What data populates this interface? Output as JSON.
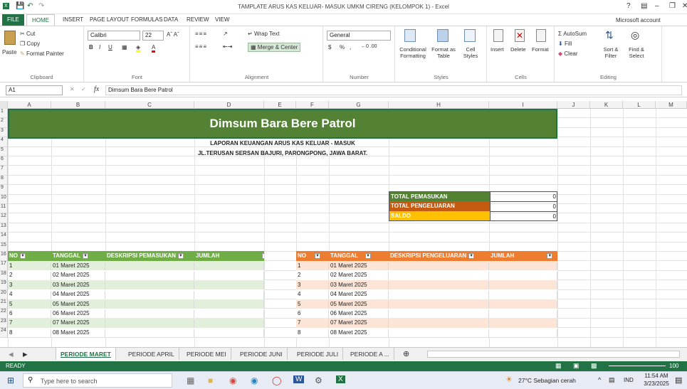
{
  "window": {
    "title": "TAMPLATE ARUS KAS KELUAR- MASUK UMKM CIRENG (KELOMPOK 1) - Excel",
    "help": "?",
    "account": "Microsoft account"
  },
  "tabs": [
    "FILE",
    "HOME",
    "INSERT",
    "PAGE LAYOUT",
    "FORMULAS",
    "DATA",
    "REVIEW",
    "VIEW"
  ],
  "ribbon": {
    "clipboard": {
      "paste": "Paste",
      "cut": "Cut",
      "copy": "Copy",
      "format_painter": "Format Painter",
      "label": "Clipboard"
    },
    "font": {
      "name": "Calibri",
      "size": "22",
      "label": "Font",
      "bold": "B",
      "italic": "I",
      "underline": "U"
    },
    "alignment": {
      "wrap": "Wrap Text",
      "merge": "Merge & Center",
      "label": "Alignment"
    },
    "number": {
      "format": "General",
      "currency": "$",
      "percent": "%",
      "comma": ",",
      "label": "Number"
    },
    "styles": {
      "cond": "Conditional Formatting",
      "table": "Format as Table",
      "cell": "Cell Styles",
      "label": "Styles"
    },
    "cells": {
      "insert": "Insert",
      "delete": "Delete",
      "format": "Format",
      "label": "Cells"
    },
    "editing": {
      "autosum": "AutoSum",
      "fill": "Fill",
      "clear": "Clear",
      "sort": "Sort & Filter",
      "find": "Find & Select",
      "label": "Editing"
    }
  },
  "formula_bar": {
    "name_box": "A1",
    "fx": "fx",
    "content": "Dimsum Bara Bere Patrol"
  },
  "columns": [
    "A",
    "B",
    "C",
    "D",
    "E",
    "F",
    "G",
    "H",
    "I",
    "J",
    "K",
    "L",
    "M"
  ],
  "rows": [
    "1",
    "2",
    "3",
    "4",
    "5",
    "6",
    "7",
    "8",
    "9",
    "10",
    "11",
    "12",
    "13",
    "14",
    "15",
    "16",
    "17",
    "18",
    "19",
    "20",
    "21",
    "22",
    "23",
    "24"
  ],
  "sheet": {
    "title": "Dimsum Bara Bere Patrol",
    "subtitle": "LAPORAN KEUANGAN ARUS KAS KELUAR - MASUK",
    "address": "JL.TERUSAN SERSAN BAJURI, PARONGPONG, JAWA BARAT.",
    "summary": [
      {
        "label": "TOTAL PEMASUKAN",
        "value": "0",
        "color": "#548235"
      },
      {
        "label": "TOTAL PENGELUARAN",
        "value": "0",
        "color": "#c55a11"
      },
      {
        "label": "SALDO",
        "value": "0",
        "color": "#ffc000"
      }
    ],
    "income_headers": [
      "NO",
      "TANGGAL",
      "DESKRIPSI PEMASUKAN",
      "JUMLAH"
    ],
    "expense_headers": [
      "NO",
      "TANGGAL",
      "DESKRIPSI PENGELUARAN",
      "JUMLAH"
    ],
    "income_rows": [
      {
        "no": "1",
        "date": "01 Maret 2025"
      },
      {
        "no": "2",
        "date": "02 Maret 2025"
      },
      {
        "no": "3",
        "date": "03 Maret 2025"
      },
      {
        "no": "4",
        "date": "04 Maret 2025"
      },
      {
        "no": "5",
        "date": "05 Maret 2025"
      },
      {
        "no": "6",
        "date": "06 Maret 2025"
      },
      {
        "no": "7",
        "date": "07 Maret 2025"
      },
      {
        "no": "8",
        "date": "08 Maret 2025"
      }
    ],
    "expense_rows": [
      {
        "no": "1",
        "date": "01 Maret 2025"
      },
      {
        "no": "2",
        "date": "02 Maret 2025"
      },
      {
        "no": "3",
        "date": "03 Maret 2025"
      },
      {
        "no": "4",
        "date": "04 Maret 2025"
      },
      {
        "no": "5",
        "date": "05 Maret 2025"
      },
      {
        "no": "6",
        "date": "06 Maret 2025"
      },
      {
        "no": "7",
        "date": "07 Maret 2025"
      },
      {
        "no": "8",
        "date": "08 Maret 2025"
      }
    ]
  },
  "sheet_tabs": [
    "PERIODE MARET",
    "PERIODE APRIL",
    "PERIODE MEI",
    "PERIODE JUNI",
    "PERIODE JULI",
    "PERIODE A ..."
  ],
  "status": {
    "ready": "READY",
    "zoom": "100"
  },
  "taskbar": {
    "search": "Type here to search",
    "weather": "27°C  Sebagian cerah",
    "lang": "IND",
    "time": "11:54 AM",
    "date": "3/23/2025"
  },
  "colors": {
    "excel_green": "#217346",
    "title_green": "#548235",
    "income_header": "#70ad47",
    "income_band": "#e2efda",
    "expense_header": "#ed7d31",
    "expense_band": "#fce4d6"
  }
}
